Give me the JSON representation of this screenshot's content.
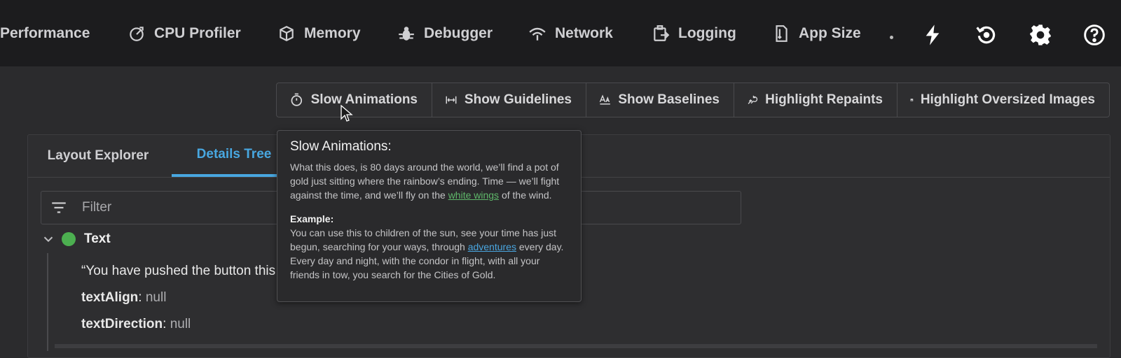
{
  "nav": {
    "tabs": [
      {
        "label": "Performance",
        "icon": "performance-icon"
      },
      {
        "label": "CPU Profiler",
        "icon": "cpu-profiler-icon"
      },
      {
        "label": "Memory",
        "icon": "memory-icon"
      },
      {
        "label": "Debugger",
        "icon": "debugger-icon"
      },
      {
        "label": "Network",
        "icon": "network-icon"
      },
      {
        "label": "Logging",
        "icon": "logging-icon"
      },
      {
        "label": "App Size",
        "icon": "app-size-icon"
      }
    ],
    "tools": [
      "hot-reload-icon",
      "hot-restart-icon",
      "settings-icon",
      "help-icon"
    ]
  },
  "toolbar": {
    "buttons": [
      {
        "label": "Slow Animations",
        "icon": "timer-icon"
      },
      {
        "label": "Show Guidelines",
        "icon": "guidelines-icon"
      },
      {
        "label": "Show Baselines",
        "icon": "baselines-icon"
      },
      {
        "label": "Highlight Repaints",
        "icon": "repaint-icon"
      },
      {
        "label": "Highlight Oversized Images",
        "icon": "image-icon"
      }
    ]
  },
  "panel": {
    "tabs": [
      "Layout Explorer",
      "Details Tree"
    ],
    "active_tab": "Details Tree",
    "filter_placeholder": "Filter",
    "node_label": "Text",
    "props": [
      {
        "text": "“You have pushed the button this"
      },
      {
        "key": "textAlign",
        "value": "null"
      },
      {
        "key": "textDirection",
        "value": "null"
      }
    ]
  },
  "tooltip": {
    "title": "Slow Animations:",
    "p1_before": "What this does, is 80 days around the world, we’ll find a pot of gold just sitting where the rainbow’s ending. Time — we’ll fight against the time, and we’ll fly on the ",
    "p1_link": "white wings",
    "p1_after": " of the wind.",
    "example_heading": "Example:",
    "p2_before": "You can use this to children of the sun, see your time has just begun, searching for your ways, through ",
    "p2_link": "adventures",
    "p2_after": " every day. Every day and night, with the condor in flight, with all your friends in tow, you search for the Cities of Gold."
  },
  "colors": {
    "accent": "#48a7e0",
    "status_green": "#4caf50",
    "topbar_bg": "#1c1c1e",
    "page_bg": "#2b2b2d"
  }
}
